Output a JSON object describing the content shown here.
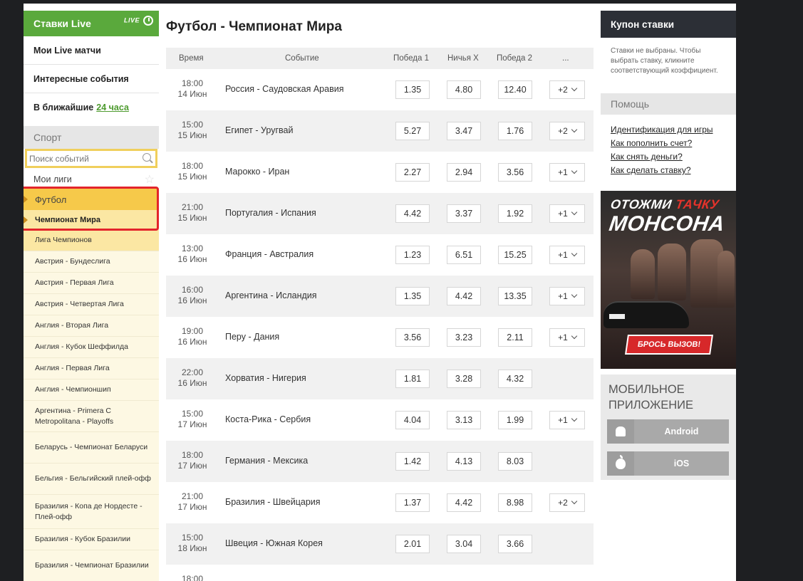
{
  "sidebar": {
    "live_header": "Ставки Live",
    "live_badge": "LIVE",
    "my_live": "Мои Live матчи",
    "interesting": "Интересные события",
    "nearest_prefix": "В ближайшие",
    "nearest_link": "24 часа",
    "sport_title": "Спорт",
    "search_placeholder": "Поиск событий",
    "my_leagues": "Мои лиги",
    "sport_selected": "Футбол",
    "league_selected": "Чемпионат Мира",
    "leagues": [
      "Лига Чемпионов",
      "Австрия - Бундеслига",
      "Австрия - Первая Лига",
      "Австрия - Четвертая Лига",
      "Англия - Вторая Лига",
      "Англия - Кубок Шеффилда",
      "Англия - Первая Лига",
      "Англия - Чемпионшип",
      "Аргентина - Primera C Metropolitana - Playoffs",
      "Беларусь - Чемпионат Беларуси",
      "Бельгия - Бельгийский плей-офф",
      "Бразилия - Копа де Нордесте - Плей-офф",
      "Бразилия - Кубок Бразилии",
      "Бразилия - Чемпионат Бразилии"
    ]
  },
  "main": {
    "title": "Футбол - Чемпионат Мира",
    "columns": {
      "time": "Время",
      "event": "Событие",
      "win1": "Победа 1",
      "draw": "Ничья X",
      "win2": "Победа 2",
      "more": "..."
    },
    "rows": [
      {
        "time": "18:00",
        "date": "14 Июн",
        "event": "Россия - Саудовская Аравия",
        "w1": "1.35",
        "x": "4.80",
        "w2": "12.40",
        "more": "+2"
      },
      {
        "time": "15:00",
        "date": "15 Июн",
        "event": "Египет - Уругвай",
        "w1": "5.27",
        "x": "3.47",
        "w2": "1.76",
        "more": "+2"
      },
      {
        "time": "18:00",
        "date": "15 Июн",
        "event": "Марокко - Иран",
        "w1": "2.27",
        "x": "2.94",
        "w2": "3.56",
        "more": "+1"
      },
      {
        "time": "21:00",
        "date": "15 Июн",
        "event": "Португалия - Испания",
        "w1": "4.42",
        "x": "3.37",
        "w2": "1.92",
        "more": "+1"
      },
      {
        "time": "13:00",
        "date": "16 Июн",
        "event": "Франция - Австралия",
        "w1": "1.23",
        "x": "6.51",
        "w2": "15.25",
        "more": "+1"
      },
      {
        "time": "16:00",
        "date": "16 Июн",
        "event": "Аргентина - Исландия",
        "w1": "1.35",
        "x": "4.42",
        "w2": "13.35",
        "more": "+1"
      },
      {
        "time": "19:00",
        "date": "16 Июн",
        "event": "Перу - Дания",
        "w1": "3.56",
        "x": "3.23",
        "w2": "2.11",
        "more": "+1"
      },
      {
        "time": "22:00",
        "date": "16 Июн",
        "event": "Хорватия - Нигерия",
        "w1": "1.81",
        "x": "3.28",
        "w2": "4.32",
        "more": ""
      },
      {
        "time": "15:00",
        "date": "17 Июн",
        "event": "Коста-Рика - Сербия",
        "w1": "4.04",
        "x": "3.13",
        "w2": "1.99",
        "more": "+1"
      },
      {
        "time": "18:00",
        "date": "17 Июн",
        "event": "Германия - Мексика",
        "w1": "1.42",
        "x": "4.13",
        "w2": "8.03",
        "more": ""
      },
      {
        "time": "21:00",
        "date": "17 Июн",
        "event": "Бразилия - Швейцария",
        "w1": "1.37",
        "x": "4.42",
        "w2": "8.98",
        "more": "+2"
      },
      {
        "time": "15:00",
        "date": "18 Июн",
        "event": "Швеция - Южная Корея",
        "w1": "2.01",
        "x": "3.04",
        "w2": "3.66",
        "more": ""
      },
      {
        "time": "18:00",
        "date": "",
        "event": "",
        "w1": "",
        "x": "",
        "w2": "",
        "more": ""
      }
    ]
  },
  "right": {
    "coupon_title": "Купон ставки",
    "coupon_text": "Ставки не выбраны. Чтобы выбрать ставку, кликните соответствующий коэффициент.",
    "help_title": "Помощь",
    "help_links": [
      "Идентификация для игры",
      "Как пополнить счет?",
      "Как снять деньги?",
      "Как сделать ставку?"
    ],
    "banner_line1_a": "ОТОЖМИ",
    "banner_line1_b": "ТАЧКУ",
    "banner_line2": "МОНСОНА",
    "banner_cta": "БРОСЬ ВЫЗОВ!",
    "mobile_title_1": "МОБИЛЬНОЕ",
    "mobile_title_2": "ПРИЛОЖЕНИЕ",
    "android_label": "Android",
    "ios_label": "iOS"
  }
}
